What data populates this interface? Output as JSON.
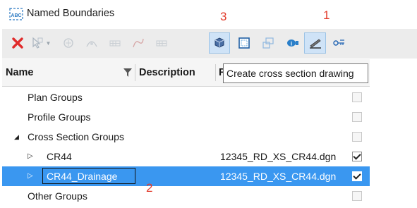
{
  "window": {
    "title": "Named Boundaries",
    "icon": "named-boundaries-app-icon"
  },
  "annotations": {
    "one": "1",
    "two": "2",
    "three": "3"
  },
  "toolbar": {
    "buttons": [
      {
        "name": "delete",
        "icon": "red-x-icon",
        "color": "#e02b2b"
      },
      {
        "name": "select-tool",
        "icon": "selection-icon",
        "dropdown": true
      },
      {
        "name": "tool-3",
        "icon": "grayed-shape-icon"
      },
      {
        "name": "tool-4",
        "icon": "grayed-shape-icon"
      },
      {
        "name": "tool-5",
        "icon": "grayed-table-icon"
      },
      {
        "name": "tool-6",
        "icon": "grayed-curve-icon"
      },
      {
        "name": "tool-7",
        "icon": "grayed-table-icon"
      },
      {
        "name": "create-cross-section-drawing",
        "icon": "cross-section-cube-icon",
        "pressed": true
      },
      {
        "name": "tool-9",
        "icon": "boundary-frame-icon"
      },
      {
        "name": "tool-10",
        "icon": "grayed-frame-icon"
      },
      {
        "name": "tool-11",
        "icon": "info-icon"
      },
      {
        "name": "tool-12",
        "icon": "pencil-icon",
        "pressed": true
      },
      {
        "name": "tool-13",
        "icon": "key-icon"
      }
    ]
  },
  "tooltip": {
    "text": "Create cross section drawing"
  },
  "grid": {
    "columns": {
      "name": "Name",
      "description": "Description",
      "file": "F"
    },
    "rows": [
      {
        "name": "Plan Groups",
        "file": "",
        "checked": false,
        "expander": "",
        "selected": false
      },
      {
        "name": "Profile Groups",
        "file": "",
        "checked": false,
        "expander": "",
        "selected": false
      },
      {
        "name": "Cross Section Groups",
        "file": "",
        "checked": false,
        "expander": "◢",
        "selected": false
      },
      {
        "name": "CR44",
        "file": "12345_RD_XS_CR44.dgn",
        "checked": true,
        "expander": "▷",
        "selected": false
      },
      {
        "name": "CR44_Drainage",
        "file": "12345_RD_XS_CR44.dgn",
        "checked": true,
        "expander": "▷",
        "selected": true
      },
      {
        "name": "Other Groups",
        "file": "",
        "checked": false,
        "expander": "",
        "selected": false
      }
    ]
  },
  "colors": {
    "selection": "#3a97f0",
    "annotation": "#e23b2b",
    "toolbar_bg": "#ececec"
  }
}
